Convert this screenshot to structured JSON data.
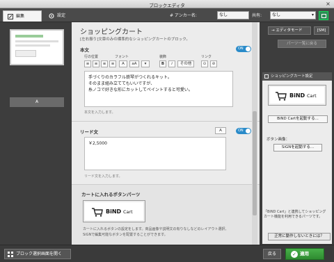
{
  "window": {
    "title": "ブロックエディタ",
    "close_glyph": "×"
  },
  "topbar": {
    "tab_edit": "編集",
    "tab_settings": "設定",
    "anchor_label": "# アンカー名:",
    "anchor_value": "なし",
    "share_label": "共有:",
    "share_value": "なし",
    "share_arrow": "▾"
  },
  "left": {
    "block_label": "A"
  },
  "main": {
    "title": "ショッピングカート",
    "description": "[左右振り]文章のみの標準的なショッピングカートのブロック。",
    "body": {
      "heading": "本文",
      "toggle": "ON",
      "lbl_align": "行の位置",
      "lbl_font": "フォント",
      "lbl_deco": "装飾",
      "lbl_link": "リンク",
      "btn_font_a": "A",
      "btn_font_size": "aA",
      "btn_bold": "B",
      "btn_italic": "i",
      "btn_other": "その他",
      "text_line1": "手づくりのカラフル鉄琴がつくれるキット。",
      "text_line2": "そのまま組み立ててもいいですが、",
      "text_line3": "糸ノコで好きな形にカットしてペイントすると可愛い。",
      "hint": "本文を入力します。"
    },
    "lead": {
      "heading": "リード文",
      "toggle": "ON",
      "btn_font_a": "A",
      "value": "￥2,5000",
      "hint": "リード文を入力します。"
    },
    "cart_parts": {
      "heading": "カートに入れるボタンパーツ",
      "bind_label": "BiND",
      "bind_sub": "Cart",
      "note_line1": "カートに入れるボタンの設定をします。商品画像や説明文の有りなしなどのレイアウト選択、",
      "note_line2": "SiGNで編集可能なボタンを配置することができます。"
    }
  },
  "right": {
    "edit_mode": "→ エディタモード",
    "sm": "[SM]",
    "parts_back": "パーツ一覧に戻る",
    "panel_title": "ショッピングカート設定",
    "bind_label": "BiND",
    "bind_sub": "Cart",
    "launch_bind": "BiND Cartを起動する...",
    "button_image_label": "ボタン画像：",
    "launch_sign": "SiGNを起動する...",
    "note": "「BiND Cart」と連携してショッピングカート機能を利用できるパーツです。",
    "help": "正常に動作しないときには？"
  },
  "bottom": {
    "open_list": "ブロック選択画面を開く",
    "back": "戻る",
    "apply": "適用",
    "apply_glyph": "✓"
  }
}
